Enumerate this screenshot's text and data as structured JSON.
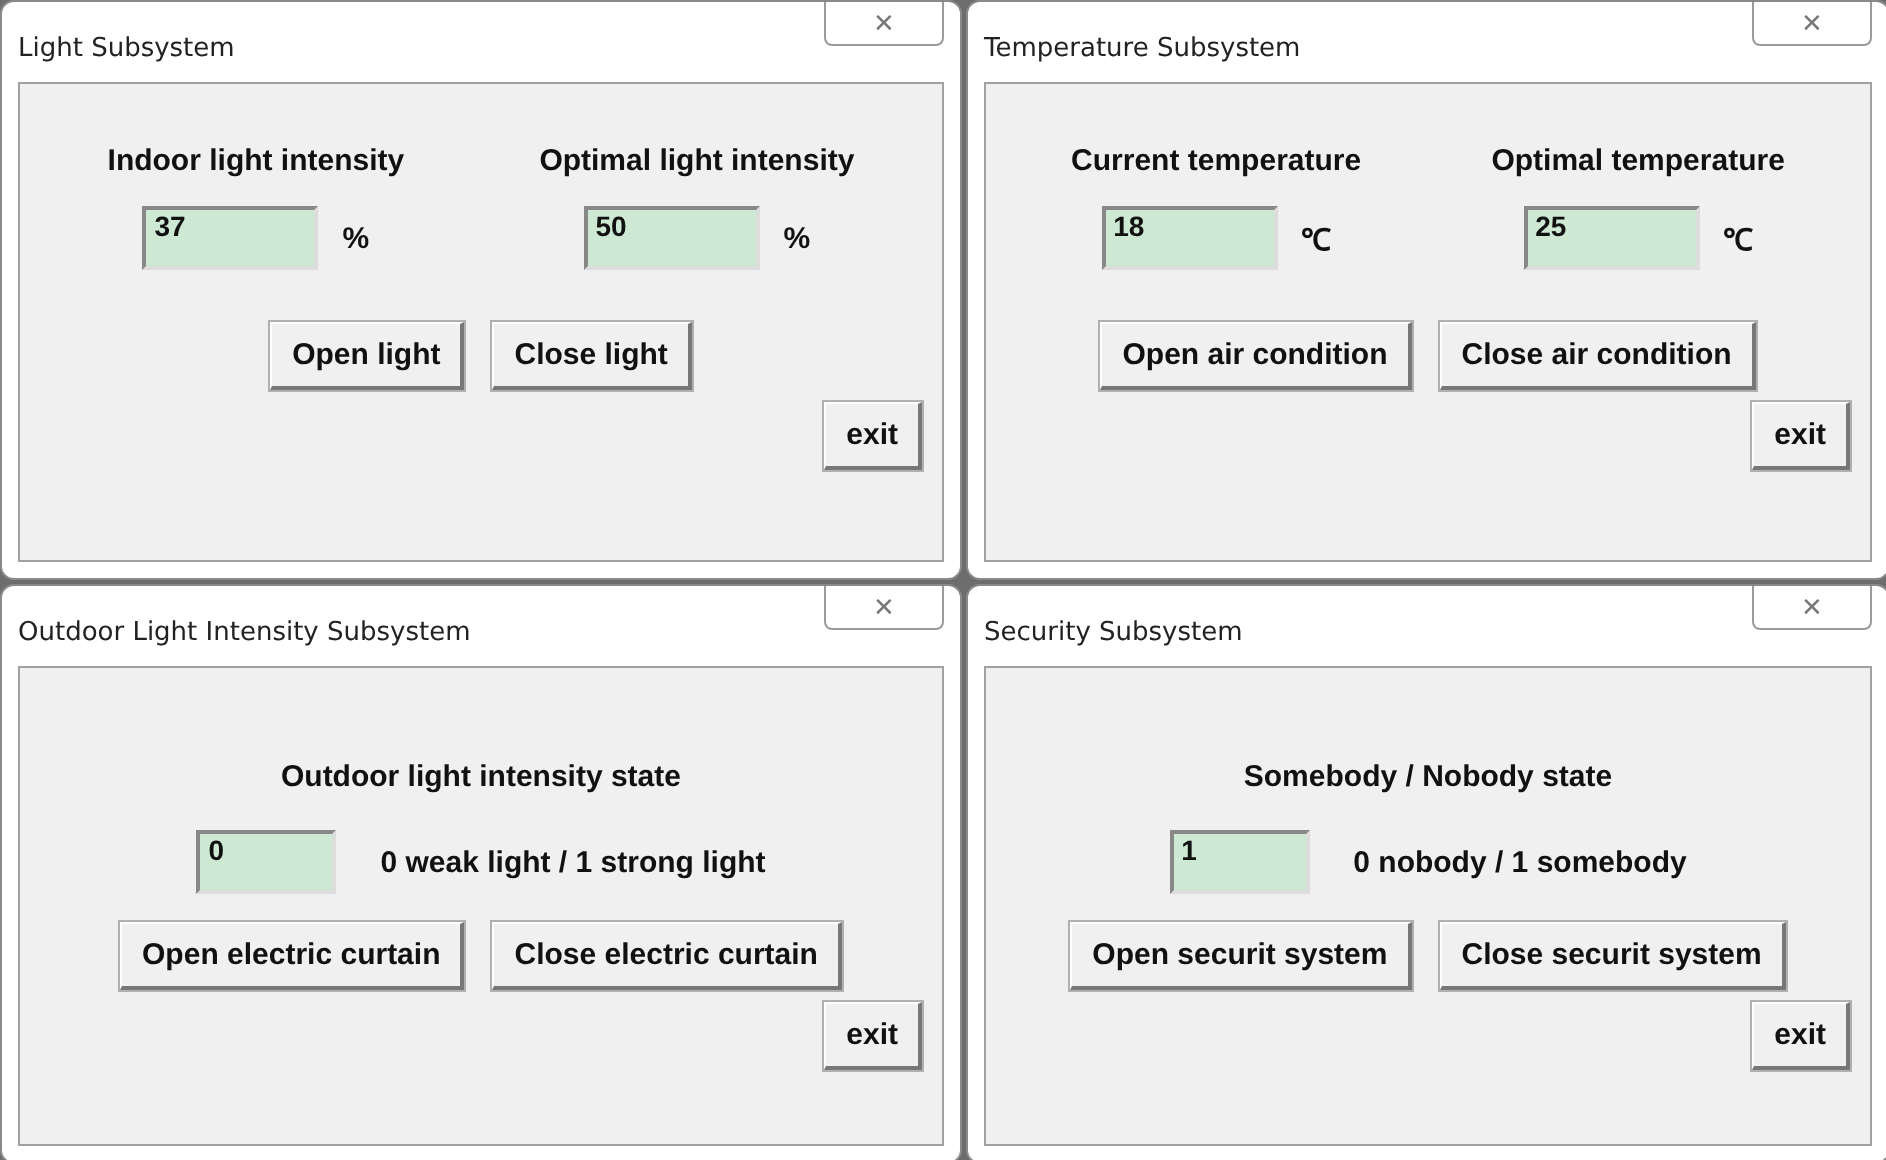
{
  "windows": [
    {
      "title": "Light Subsystem",
      "close": "✕",
      "kind": "readings",
      "readings": [
        {
          "label": "Indoor light intensity",
          "value": "37",
          "unit": "%"
        },
        {
          "label": "Optimal light intensity",
          "value": "50",
          "unit": "%"
        }
      ],
      "buttons": [
        "Open light",
        "Close light"
      ],
      "exit": "exit"
    },
    {
      "title": "Temperature Subsystem",
      "close": "✕",
      "kind": "readings",
      "readings": [
        {
          "label": "Current temperature",
          "value": "18",
          "unit": "℃"
        },
        {
          "label": "Optimal temperature",
          "value": "25",
          "unit": "℃"
        }
      ],
      "buttons": [
        "Open air condition",
        "Close air condition"
      ],
      "exit": "exit"
    },
    {
      "title": "Outdoor Light Intensity Subsystem",
      "close": "✕",
      "kind": "state",
      "label": "Outdoor light intensity state",
      "value": "0",
      "note": "0 weak light / 1 strong light",
      "buttons": [
        "Open electric curtain",
        "Close electric curtain"
      ],
      "exit": "exit"
    },
    {
      "title": "Security Subsystem",
      "close": "✕",
      "kind": "state",
      "label": "Somebody / Nobody state",
      "value": "1",
      "note": "0 nobody / 1 somebody",
      "buttons": [
        "Open securit system",
        "Close securit system"
      ],
      "exit": "exit"
    }
  ]
}
